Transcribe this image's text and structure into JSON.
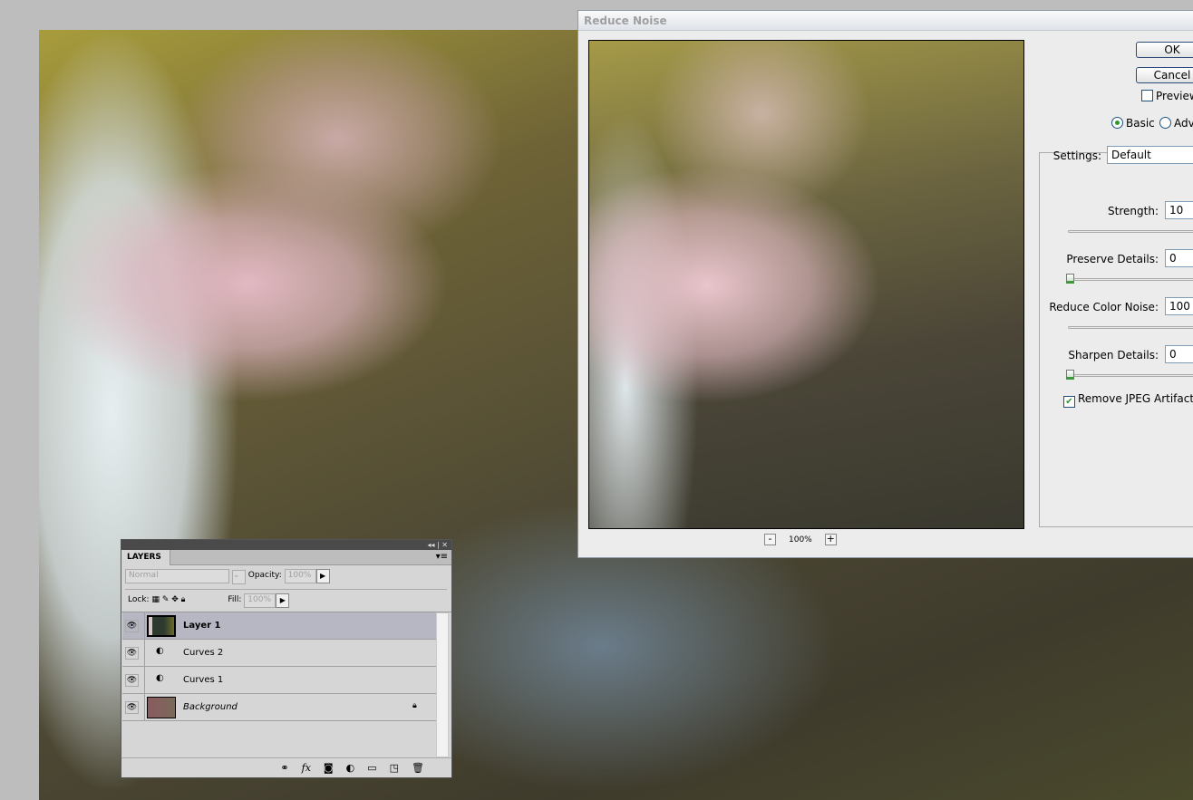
{
  "dialog": {
    "title": "Reduce Noise",
    "ok": "OK",
    "cancel": "Cancel",
    "preview_label": "Preview",
    "preview_checked": false,
    "mode_basic": "Basic",
    "mode_advanced": "Adv",
    "zoom": "100%",
    "zoom_out": "-",
    "zoom_in": "+",
    "settings_label": "Settings:",
    "settings_value": "Default",
    "strength_label": "Strength:",
    "strength": "10",
    "preserve_label": "Preserve Details:",
    "preserve": "0",
    "color_noise_label": "Reduce Color Noise:",
    "color_noise": "100",
    "sharpen_label": "Sharpen Details:",
    "sharpen": "0",
    "jpeg_label": "Remove JPEG Artifact",
    "jpeg_checked": true
  },
  "layers": {
    "tab": "LAYERS",
    "blend_mode": "Normal",
    "opacity_label": "Opacity:",
    "opacity": "100%",
    "lock_label": "Lock:",
    "fill_label": "Fill:",
    "fill": "100%",
    "items": [
      {
        "name": "Layer 1"
      },
      {
        "name": "Curves 2"
      },
      {
        "name": "Curves 1"
      },
      {
        "name": "Background"
      }
    ],
    "footer_icons": [
      "link-icon",
      "fx-icon",
      "mask-icon",
      "adjustment-icon",
      "folder-icon",
      "new-layer-icon",
      "trash-icon"
    ]
  }
}
